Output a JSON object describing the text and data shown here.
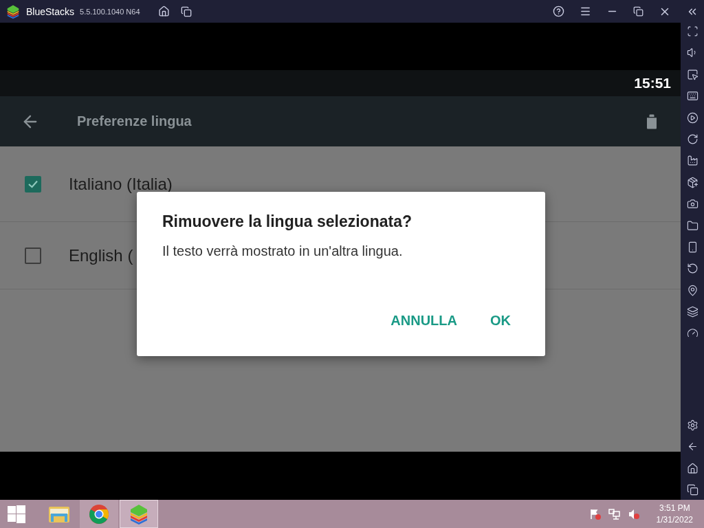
{
  "window": {
    "title": "BlueStacks",
    "version": "5.5.100.1040 N64"
  },
  "android": {
    "status_bar": {
      "time": "15:51"
    },
    "app_bar": {
      "title": "Preferenze lingua"
    },
    "languages": [
      {
        "label": "Italiano (Italia)",
        "checked": true
      },
      {
        "label": "English (",
        "checked": false
      }
    ],
    "dialog": {
      "title": "Rimuovere la lingua selezionata?",
      "message": "Il testo verrà mostrato in un'altra lingua.",
      "buttons": [
        "ANNULLA",
        "OK"
      ]
    }
  },
  "taskbar": {
    "apps": [
      {
        "kind": "files",
        "open": false,
        "selected": false
      },
      {
        "kind": "chrome",
        "open": true,
        "selected": false
      },
      {
        "kind": "bluestacks",
        "open": true,
        "selected": true
      }
    ],
    "clock": {
      "time": "3:51 PM",
      "date": "1/31/2022"
    }
  }
}
